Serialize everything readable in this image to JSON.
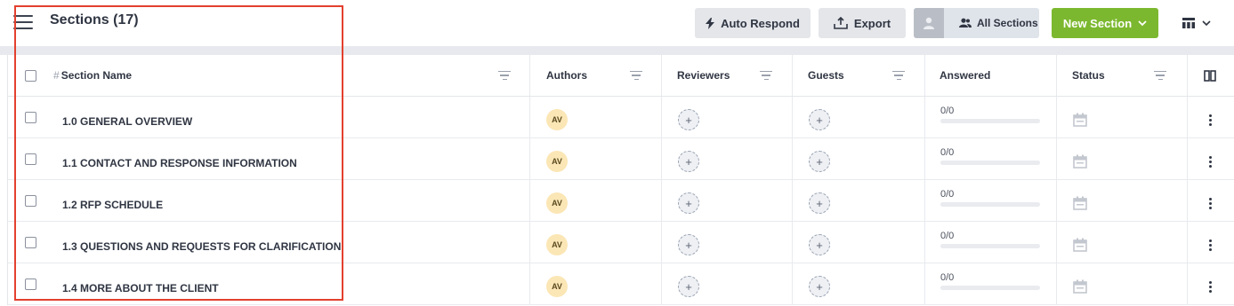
{
  "header": {
    "title": "Sections (17)",
    "auto_respond_label": "Auto Respond",
    "export_label": "Export",
    "all_sections_label": "All Sections",
    "new_section_label": "New Section"
  },
  "table": {
    "columns": {
      "hash": "#",
      "section_name": "Section Name",
      "authors": "Authors",
      "reviewers": "Reviewers",
      "guests": "Guests",
      "answered": "Answered",
      "status": "Status"
    },
    "rows": [
      {
        "name": "1.0 GENERAL OVERVIEW",
        "author": "AV",
        "reviewer": "+",
        "guest": "+",
        "answered": "0/0",
        "progress": 0
      },
      {
        "name": "1.1 CONTACT AND RESPONSE INFORMATION",
        "author": "AV",
        "reviewer": "+",
        "guest": "+",
        "answered": "0/0",
        "progress": 0
      },
      {
        "name": "1.2 RFP SCHEDULE",
        "author": "AV",
        "reviewer": "+",
        "guest": "+",
        "answered": "0/0",
        "progress": 0
      },
      {
        "name": "1.3 QUESTIONS AND REQUESTS FOR CLARIFICATION",
        "author": "AV",
        "reviewer": "+",
        "guest": "+",
        "answered": "0/0",
        "progress": 0
      },
      {
        "name": "1.4 MORE ABOUT THE CLIENT",
        "author": "AV",
        "reviewer": "+",
        "guest": "+",
        "answered": "0/0",
        "progress": 0
      }
    ]
  },
  "colors": {
    "accent_green": "#7cb82f",
    "highlight_red": "#e3402e",
    "author_badge": "#fbe6b5"
  },
  "icons": [
    "hamburger-icon",
    "lightning-icon",
    "upload-icon",
    "user-avatar-icon",
    "users-icon",
    "chevron-down-icon",
    "table-view-icon",
    "filter-icon",
    "columns-icon",
    "calendar-icon",
    "kebab-icon"
  ]
}
